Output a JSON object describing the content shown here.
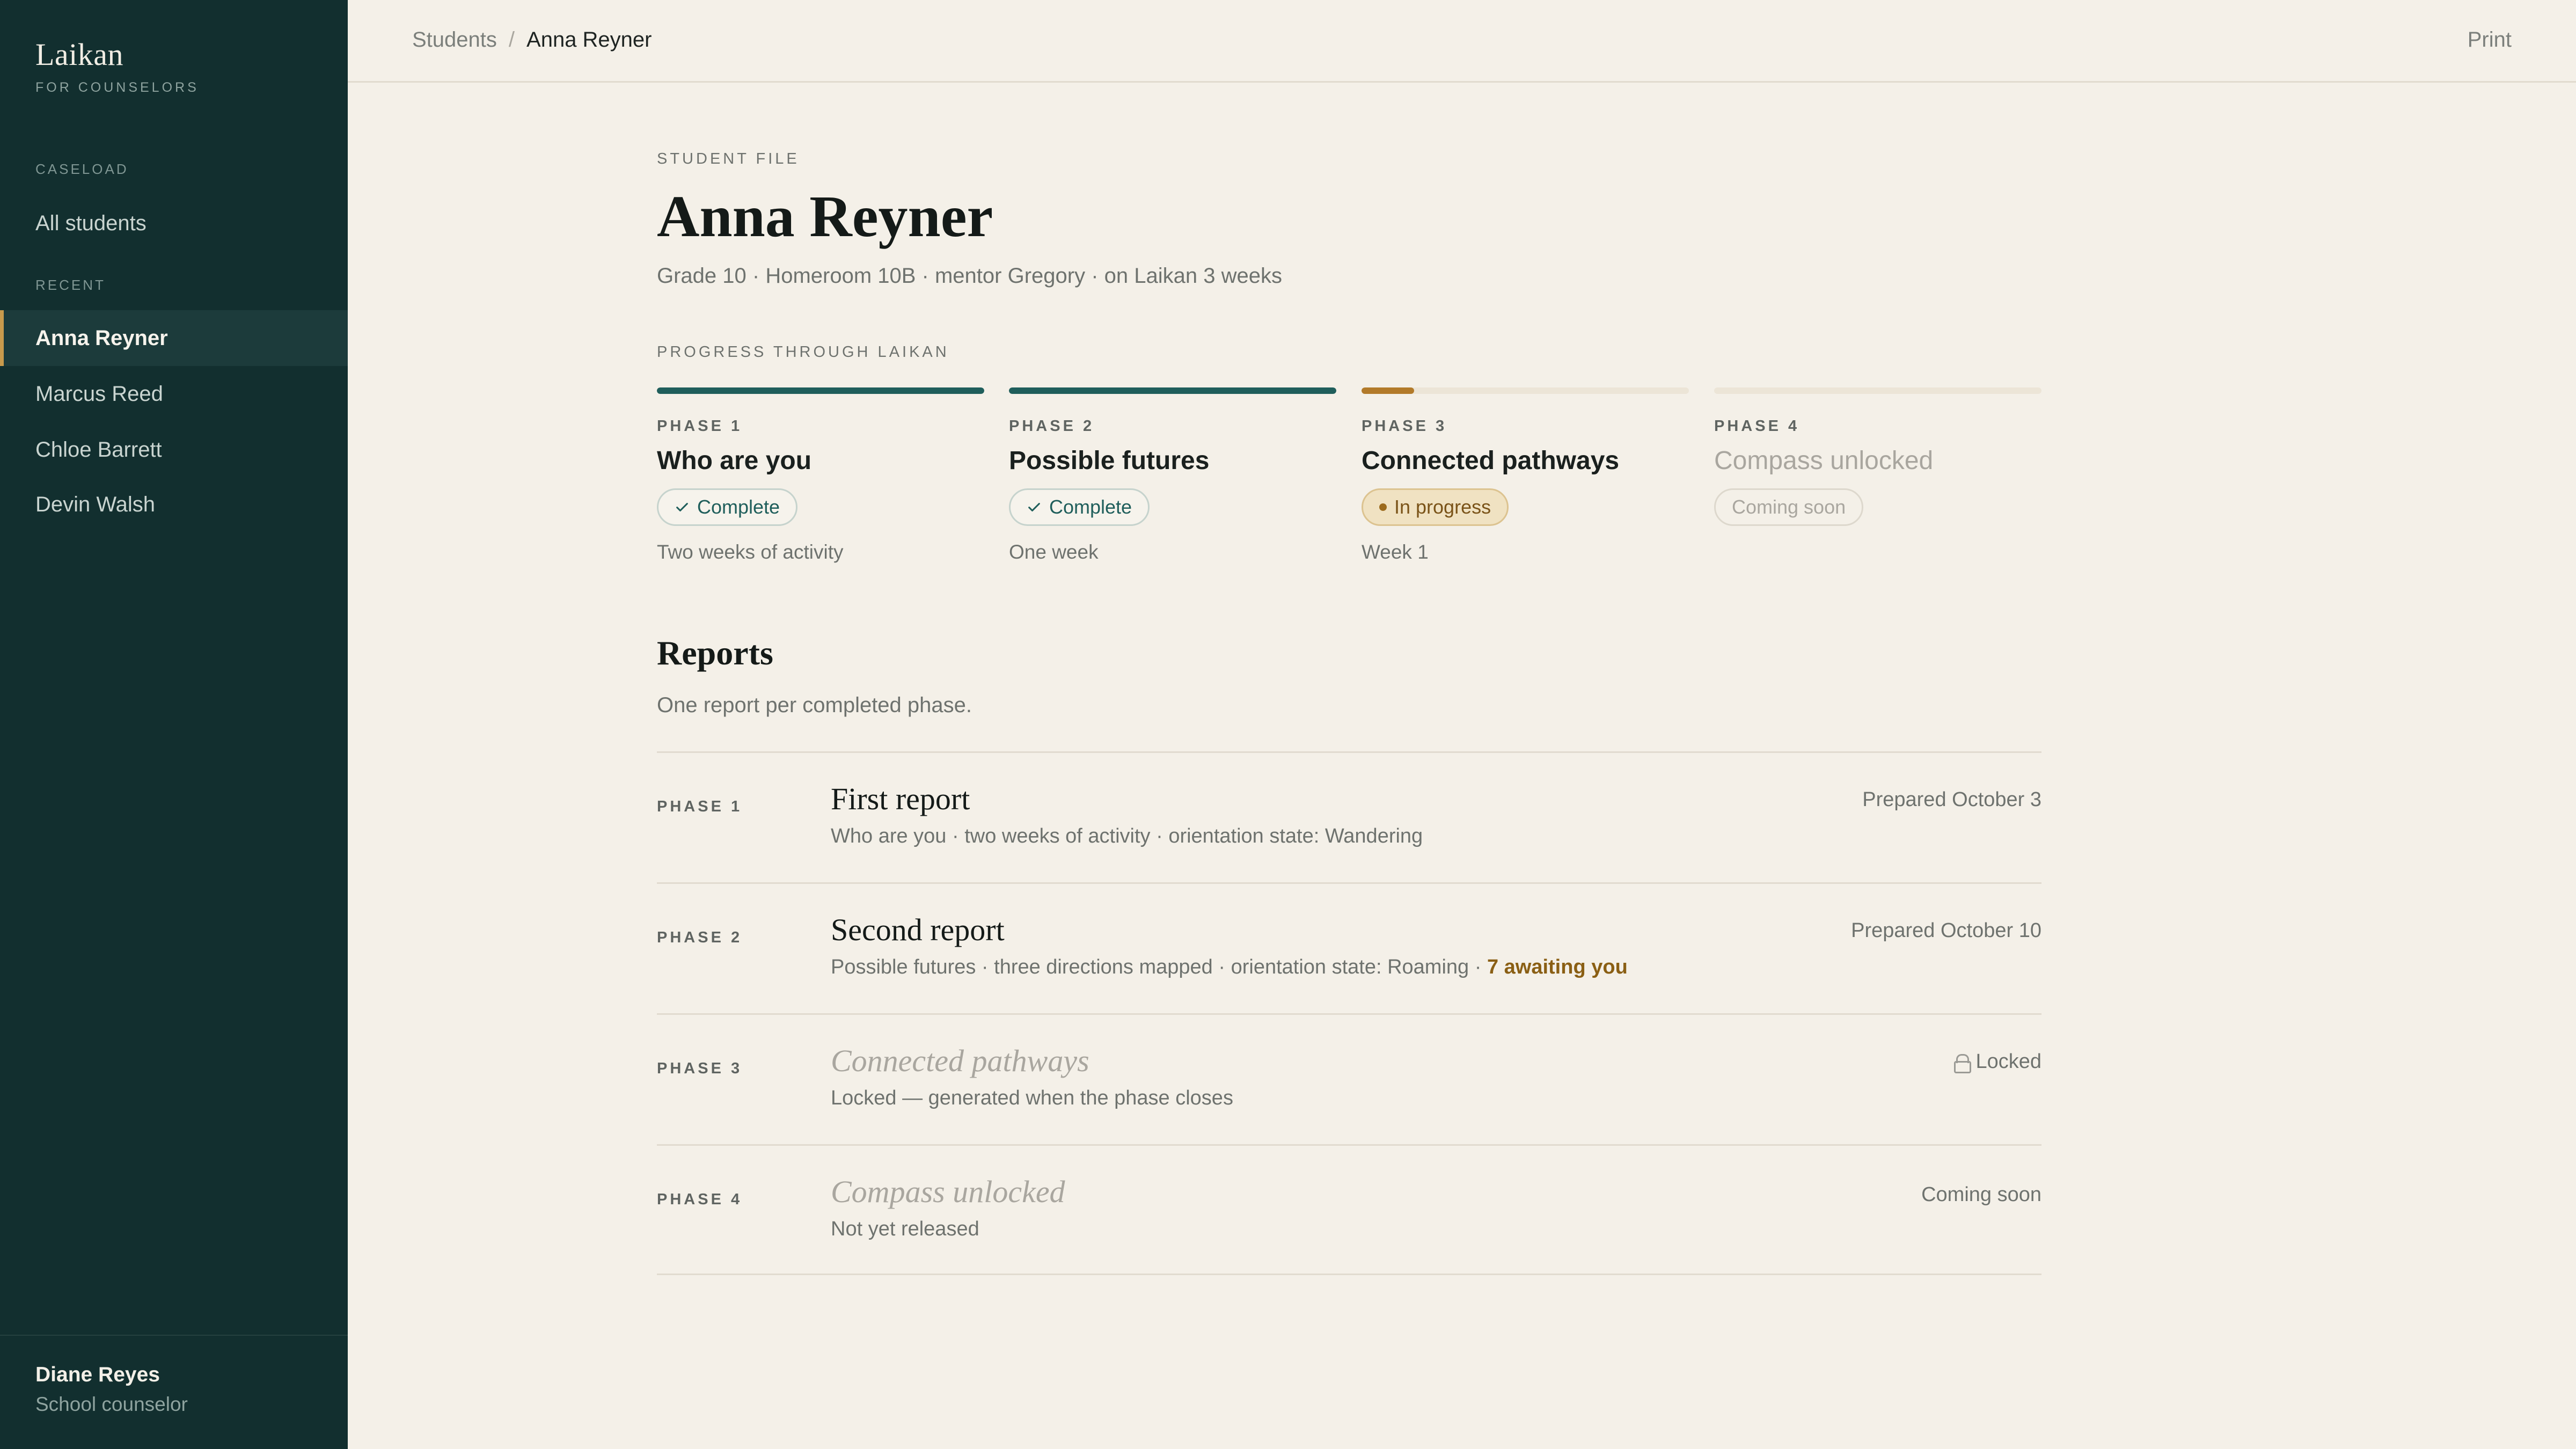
{
  "brand": {
    "name": "Laikan",
    "subtitle": "FOR COUNSELORS"
  },
  "sidebar": {
    "caseload_label": "CASELOAD",
    "all_students": "All students",
    "recent_label": "RECENT",
    "recent": [
      {
        "label": "Anna Reyner",
        "active": true
      },
      {
        "label": "Marcus Reed",
        "active": false
      },
      {
        "label": "Chloe Barrett",
        "active": false
      },
      {
        "label": "Devin Walsh",
        "active": false
      }
    ],
    "user": {
      "name": "Diane Reyes",
      "role": "School counselor"
    }
  },
  "topbar": {
    "breadcrumb": {
      "parent": "Students",
      "separator": "/",
      "current": "Anna Reyner"
    },
    "print_label": "Print"
  },
  "student": {
    "eyebrow": "STUDENT FILE",
    "name": "Anna Reyner",
    "meta": "Grade 10 · Homeroom 10B · mentor Gregory · on Laikan 3 weeks"
  },
  "progress": {
    "label": "PROGRESS THROUGH LAIKAN",
    "phases": [
      {
        "label": "PHASE 1",
        "title": "Who are you",
        "status": "Complete",
        "note": "Two weeks of activity",
        "fill": 1.0
      },
      {
        "label": "PHASE 2",
        "title": "Possible futures",
        "status": "Complete",
        "note": "One week",
        "fill": 1.0
      },
      {
        "label": "PHASE 3",
        "title": "Connected pathways",
        "status": "In progress",
        "note": "Week 1",
        "fill": 0.16
      },
      {
        "label": "PHASE 4",
        "title": "Compass unlocked",
        "status": "Coming soon",
        "note": "",
        "fill": 0
      }
    ]
  },
  "reports": {
    "title": "Reports",
    "subtitle": "One report per completed phase.",
    "items": [
      {
        "phase": "PHASE 1",
        "title": "First report",
        "desc": "Who are you · two weeks of activity · orientation state: Wandering",
        "status": "Prepared October 3"
      },
      {
        "phase": "PHASE 2",
        "title": "Second report",
        "desc": "Possible futures · three directions mapped · orientation state: Roaming · ",
        "highlight": "7 awaiting you",
        "status": "Prepared October 10"
      },
      {
        "phase": "PHASE 3",
        "title": "Connected pathways",
        "desc": "Locked — generated when the phase closes",
        "status": "Locked"
      },
      {
        "phase": "PHASE 4",
        "title": "Compass unlocked",
        "desc": "Not yet released",
        "status": "Coming soon"
      }
    ]
  },
  "colors": {
    "sidebar_bg": "#122f2f",
    "page_bg": "#f4f0e8",
    "complete": "#1f5e5b",
    "in_progress": "#b27a2a",
    "active_marker": "#c89a4c"
  },
  "icons": {
    "check": "check-icon",
    "lock": "lock-icon",
    "dot": "status-dot-icon"
  }
}
